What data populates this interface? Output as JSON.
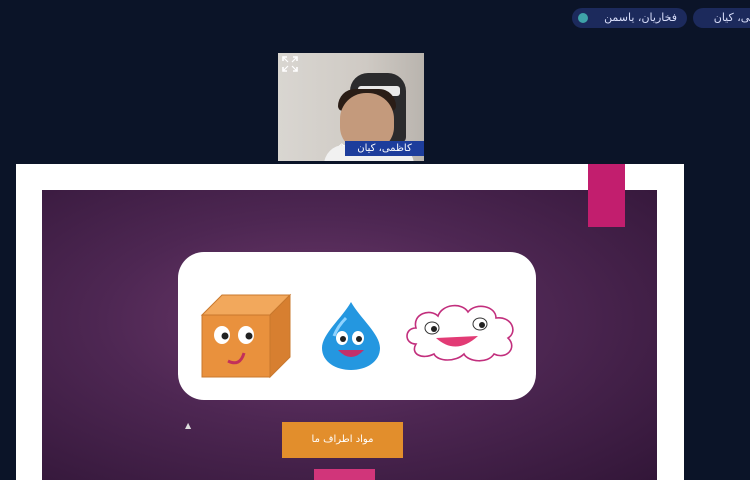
{
  "participants": {
    "chip_1": "فخاریان، یاسمن",
    "chip_2": "بی، کیان"
  },
  "video": {
    "name_label": "کاظمی، کیان",
    "expand_icon": "expand-icon",
    "caret": "^"
  },
  "slide": {
    "button_label": "مواد اطراف ما",
    "shapes": [
      "cube-character",
      "water-drop-character",
      "cloud-character"
    ]
  },
  "colors": {
    "background": "#0b1428",
    "slide_purple": "#4e2753",
    "accent_pink": "#c21e6e",
    "button_orange": "#e28e2c",
    "name_bar_blue": "#1d3d9c"
  }
}
